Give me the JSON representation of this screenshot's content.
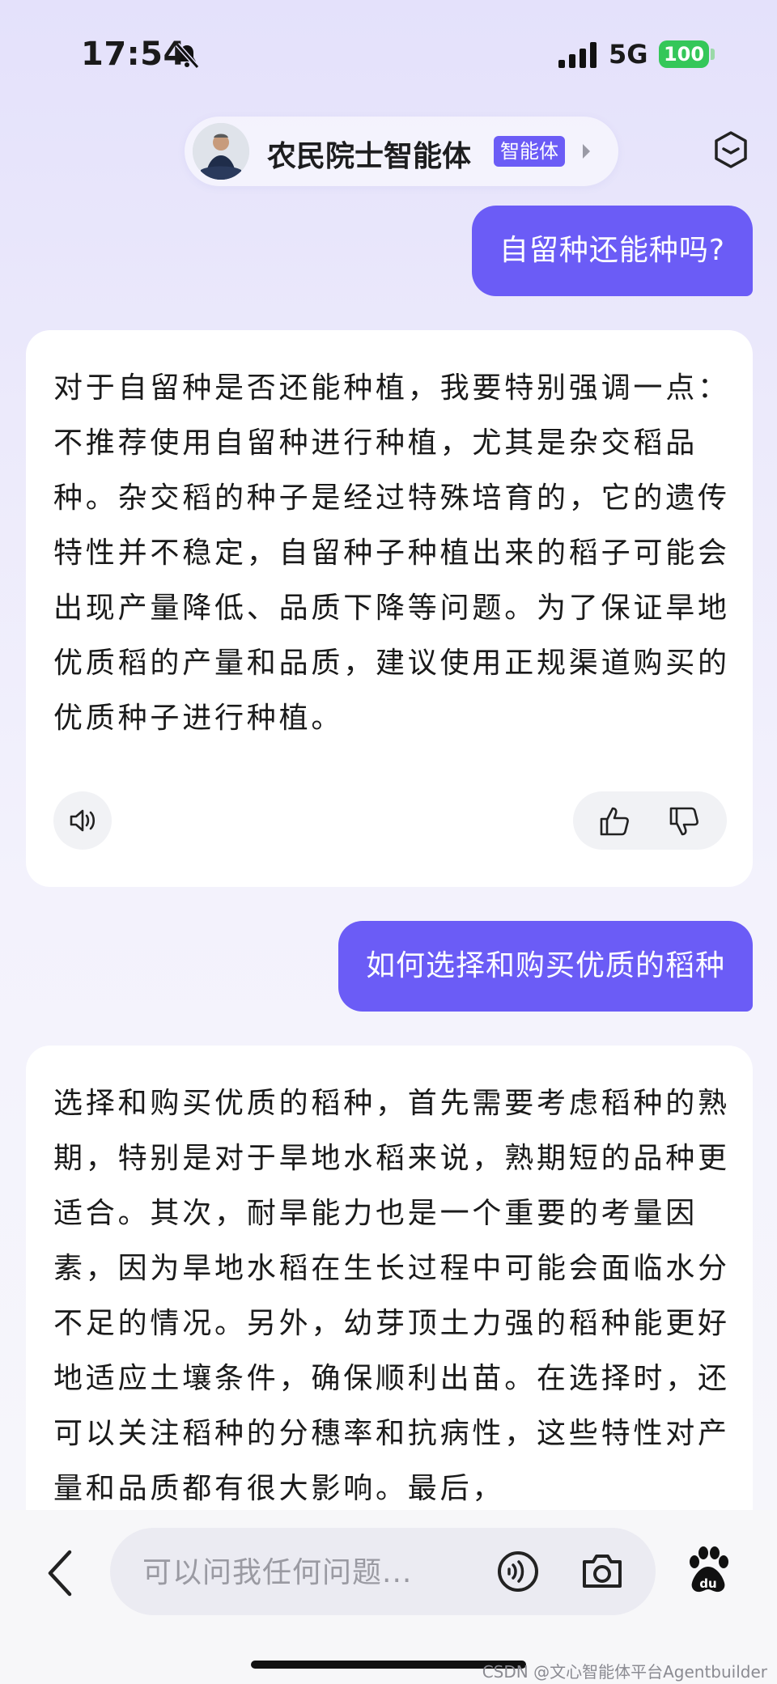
{
  "status": {
    "time": "17:54",
    "network": "5G",
    "battery": "100"
  },
  "agent": {
    "name": "农民院士智能体",
    "badge": "智能体"
  },
  "conversation": [
    {
      "role": "user",
      "text": "自留种还能种吗?"
    },
    {
      "role": "bot",
      "text": "对于自留种是否还能种植，我要特别强调一点：不推荐使用自留种进行种植，尤其是杂交稻品种。杂交稻的种子是经过特殊培育的，它的遗传特性并不稳定，自留种子种植出来的稻子可能会出现产量降低、品质下降等问题。为了保证旱地优质稻的产量和品质，建议使用正规渠道购买的优质种子进行种植。"
    },
    {
      "role": "user",
      "text": "如何选择和购买优质的稻种"
    },
    {
      "role": "bot",
      "text": "选择和购买优质的稻种，首先需要考虑稻种的熟期，特别是对于旱地水稻来说，熟期短的品种更适合。其次，耐旱能力也是一个重要的考量因素，因为旱地水稻在生长过程中可能会面临水分不足的情况。另外，幼芽顶土力强的稻种能更好地适应土壤条件，确保顺利出苗。在选择时，还可以关注稻种的分穗率和抗病性，这些特性对产量和品质都有很大影响。最后，"
    }
  ],
  "input": {
    "placeholder": "可以问我任何问题..."
  },
  "watermark": "CSDN @文心智能体平台Agentbuilder",
  "colors": {
    "accent": "#6b5cf6",
    "battery": "#34c759"
  }
}
